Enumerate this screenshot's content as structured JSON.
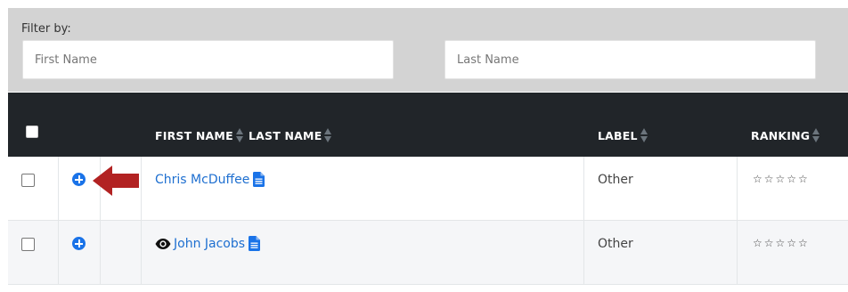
{
  "filter": {
    "label": "Filter by:",
    "first_name_placeholder": "First Name",
    "last_name_placeholder": "Last Name"
  },
  "table": {
    "headers": {
      "first_name": "FIRST NAME",
      "last_name": "LAST NAME",
      "label": "LABEL",
      "ranking": "RANKING"
    },
    "rows": [
      {
        "name": "Chris McDuffee",
        "label": "Other",
        "ranking": "☆☆☆☆☆",
        "ranking_value": 0,
        "viewed": false
      },
      {
        "name": "John Jacobs",
        "label": "Other",
        "ranking": "☆☆☆☆☆",
        "ranking_value": 0,
        "viewed": true
      }
    ]
  },
  "colors": {
    "header_bg": "#212529",
    "filter_bg": "#d3d3d3",
    "link": "#1e6fd0",
    "icon_blue": "#1a73e8",
    "arrow": "#b22222"
  }
}
